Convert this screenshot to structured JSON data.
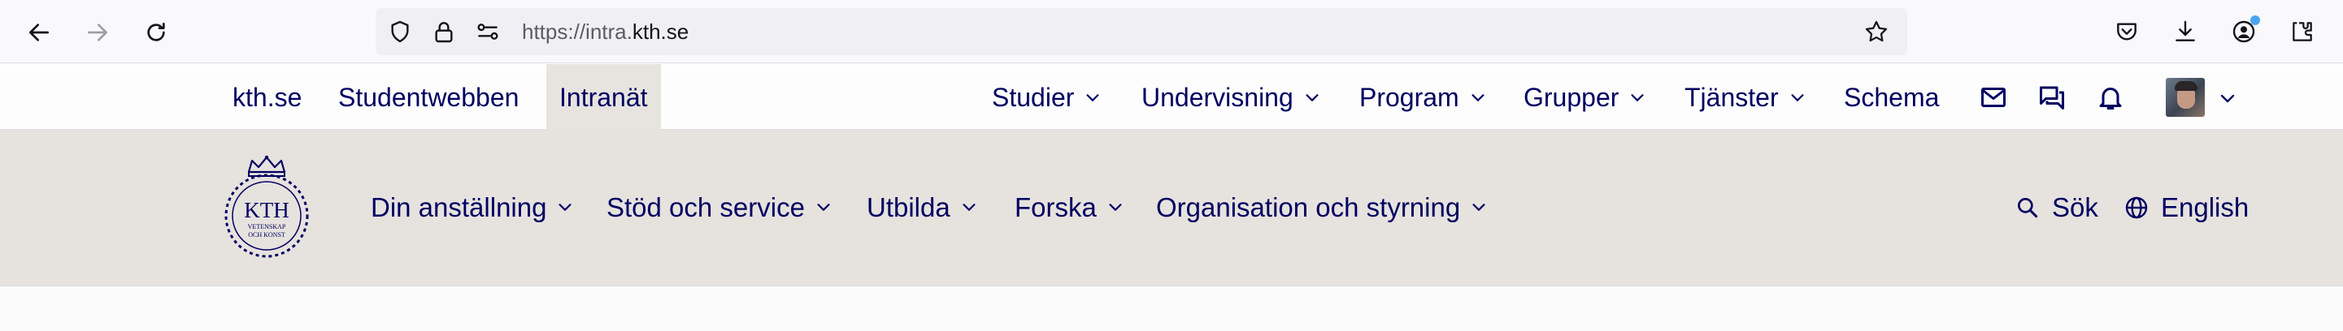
{
  "browser": {
    "url_prefix": "https://intra.",
    "url_domain": "kth.se"
  },
  "top_nav": {
    "left_links": [
      {
        "label": "kth.se"
      },
      {
        "label": "Studentwebben"
      },
      {
        "label": "Intranät",
        "active": true
      }
    ],
    "right_links": [
      {
        "label": "Studier",
        "has_dropdown": true
      },
      {
        "label": "Undervisning",
        "has_dropdown": true
      },
      {
        "label": "Program",
        "has_dropdown": true
      },
      {
        "label": "Grupper",
        "has_dropdown": true
      },
      {
        "label": "Tjänster",
        "has_dropdown": true
      },
      {
        "label": "Schema",
        "has_dropdown": false
      }
    ],
    "icons": [
      "mail-icon",
      "chat-icon",
      "bell-icon",
      "avatar"
    ]
  },
  "main_nav": {
    "logo_text": {
      "line1": "KTH",
      "line2": "VETENSKAP",
      "line3": "OCH KONST"
    },
    "links": [
      {
        "label": "Din anställning"
      },
      {
        "label": "Stöd och service"
      },
      {
        "label": "Utbilda"
      },
      {
        "label": "Forska"
      },
      {
        "label": "Organisation och styrning"
      }
    ],
    "search_label": "Sök",
    "language_label": "English"
  },
  "colors": {
    "brand_navy": "#000061",
    "header_bg": "#e6e2de",
    "active_tab_bg": "#e7e4e0"
  }
}
